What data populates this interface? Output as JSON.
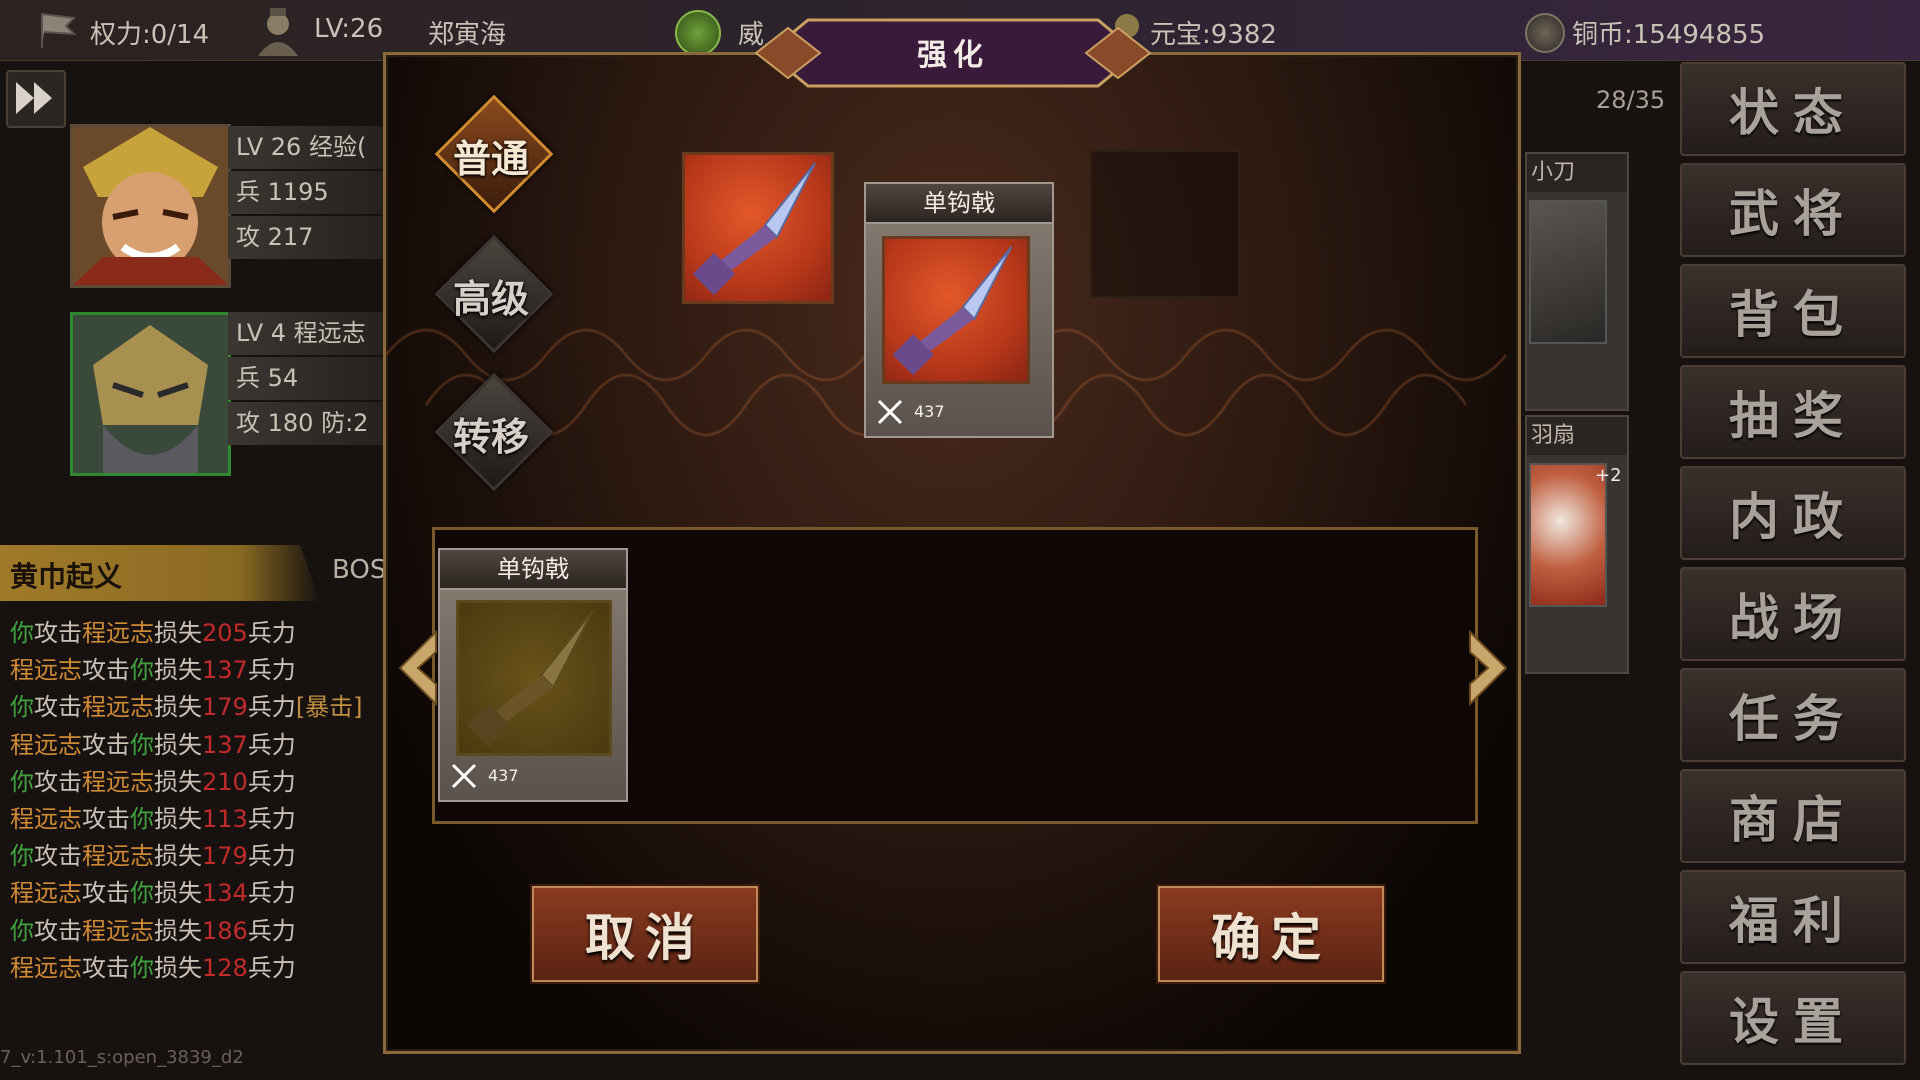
{
  "topbar": {
    "power": "权力:0/14",
    "level": "LV:26",
    "player_name": "郑寅海",
    "prestige": "威",
    "yuanbao": "元宝:9382",
    "copper": "铜币:15494855"
  },
  "heroes": [
    {
      "rows": [
        "LV 26 经验(",
        "兵 1195",
        "攻 217"
      ]
    },
    {
      "rows": [
        "LV 4   程远志",
        "兵 54",
        "攻 180  防:2"
      ]
    }
  ],
  "battle": {
    "title": "黄巾起义",
    "tab": "BOS",
    "log": [
      {
        "a": "你",
        "b": "程远志",
        "n": "205",
        "extra": ""
      },
      {
        "a": "程远志",
        "b": "你",
        "n": "137",
        "extra": ""
      },
      {
        "a": "你",
        "b": "程远志",
        "n": "179",
        "extra": "[暴击]"
      },
      {
        "a": "程远志",
        "b": "你",
        "n": "137",
        "extra": ""
      },
      {
        "a": "你",
        "b": "程远志",
        "n": "210",
        "extra": ""
      },
      {
        "a": "程远志",
        "b": "你",
        "n": "113",
        "extra": ""
      },
      {
        "a": "你",
        "b": "程远志",
        "n": "179",
        "extra": ""
      },
      {
        "a": "程远志",
        "b": "你",
        "n": "134",
        "extra": ""
      },
      {
        "a": "你",
        "b": "程远志",
        "n": "186",
        "extra": ""
      },
      {
        "a": "程远志",
        "b": "你",
        "n": "128",
        "extra": ""
      }
    ],
    "words": {
      "attack": "攻击",
      "lose": "损失",
      "troops": "兵力"
    }
  },
  "version": "7_v:1.101_s:open_3839_d2",
  "inventory": {
    "count": "28/35",
    "items": [
      "小刀",
      "羽扇"
    ],
    "badge": "+2"
  },
  "menu": [
    "状态",
    "武将",
    "背包",
    "抽奖",
    "内政",
    "战场",
    "任务",
    "商店",
    "福利",
    "设置"
  ],
  "modal": {
    "title": "强化",
    "modes": [
      "普通",
      "高级",
      "转移"
    ],
    "active_mode": 0,
    "target": {
      "name": "单钩戟",
      "attack": "437"
    },
    "list": [
      {
        "name": "单钩戟",
        "attack": "437"
      }
    ],
    "cancel": "取消",
    "confirm": "确定"
  },
  "colors": {
    "accent": "#8a6a3a",
    "player": "#3fa33f",
    "enemy": "#d08a35",
    "damage": "#c02a2a",
    "active_mode": "#d08a30"
  }
}
